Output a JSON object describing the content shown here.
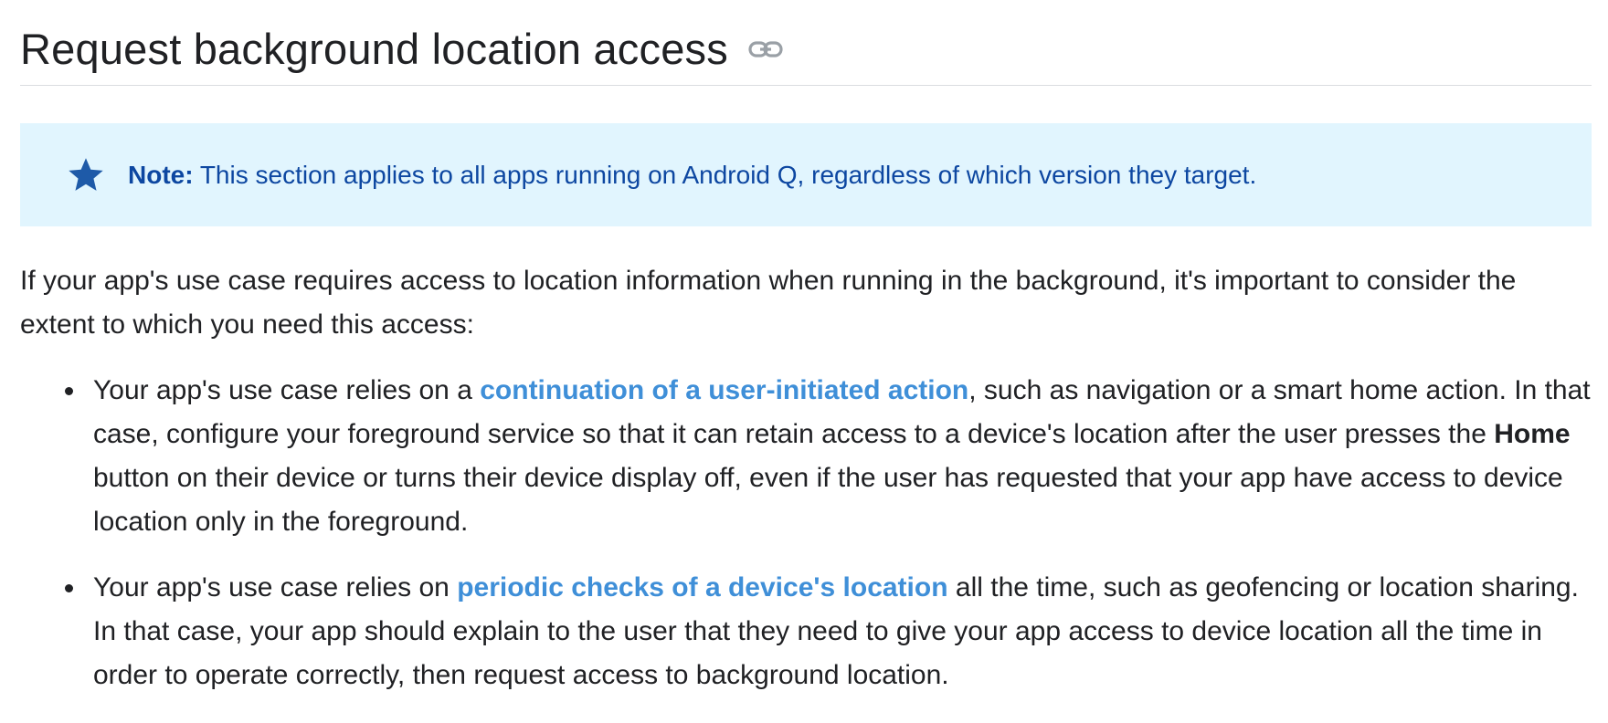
{
  "section": {
    "title": "Request background location access",
    "link_icon": "link-icon"
  },
  "note": {
    "icon": "star-icon",
    "label": "Note:",
    "text": " This section applies to all apps running on Android Q, regardless of which version they target."
  },
  "intro": "If your app's use case requires access to location information when running in the background, it's important to consider the extent to which you need this access:",
  "bullets": [
    {
      "before": "Your app's use case relies on a ",
      "link": "continuation of a user-initiated action",
      "after1": ", such as navigation or a smart home action. In that case, configure your foreground service so that it can retain access to a device's location after the user presses the ",
      "bold": "Home",
      "after2": " button on their device or turns their device display off, even if the user has requested that your app have access to device location only in the foreground."
    },
    {
      "before": "Your app's use case relies on ",
      "link": "periodic checks of a device's location",
      "after1": " all the time, such as geofencing or location sharing. In that case, your app should explain to the user that they need to give your app access to device location all the time in order to operate correctly, then request access to background location."
    }
  ],
  "colors": {
    "note_background": "#e1f5fe",
    "note_text": "#0d47a1",
    "link": "#3f8fd8",
    "text": "#202124"
  }
}
